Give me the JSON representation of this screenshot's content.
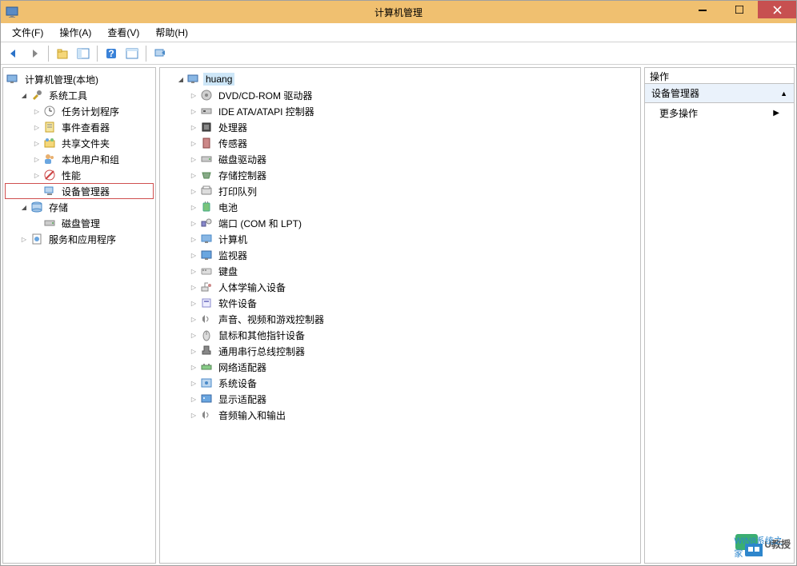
{
  "window": {
    "title": "计算机管理"
  },
  "menu": {
    "file": "文件(F)",
    "action": "操作(A)",
    "view": "查看(V)",
    "help": "帮助(H)"
  },
  "leftTree": {
    "root": "计算机管理(本地)",
    "systemTools": "系统工具",
    "taskScheduler": "任务计划程序",
    "eventViewer": "事件查看器",
    "sharedFolders": "共享文件夹",
    "localUsers": "本地用户和组",
    "performance": "性能",
    "deviceManager": "设备管理器",
    "storage": "存储",
    "diskManagement": "磁盘管理",
    "services": "服务和应用程序"
  },
  "centerTree": {
    "root": "huang",
    "items": [
      "DVD/CD-ROM 驱动器",
      "IDE ATA/ATAPI 控制器",
      "处理器",
      "传感器",
      "磁盘驱动器",
      "存储控制器",
      "打印队列",
      "电池",
      "端口 (COM 和 LPT)",
      "计算机",
      "监视器",
      "键盘",
      "人体学输入设备",
      "软件设备",
      "声音、视频和游戏控制器",
      "鼠标和其他指针设备",
      "通用串行总线控制器",
      "网络适配器",
      "系统设备",
      "显示适配器",
      "音频输入和输出"
    ]
  },
  "actions": {
    "header": "操作",
    "section": "设备管理器",
    "more": "更多操作"
  },
  "watermark": {
    "main": "U教授",
    "sub": "WIN8系统之家"
  }
}
